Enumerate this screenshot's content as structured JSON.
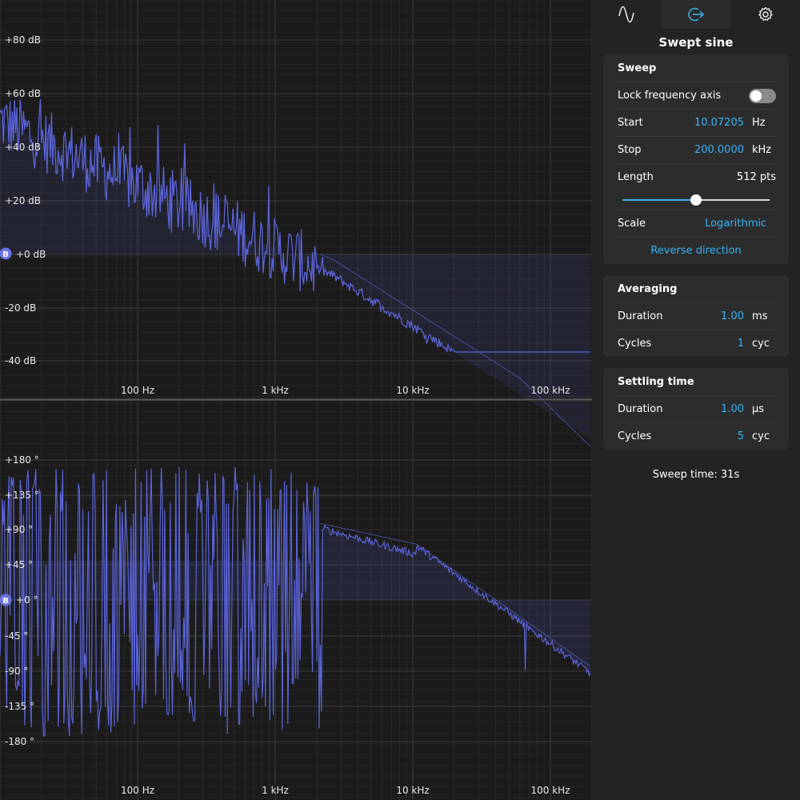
{
  "plots": {
    "magnitude": {
      "y_ticks": [
        "+80 dB",
        "+60 dB",
        "+40 dB",
        "+20 dB",
        "+0 dB",
        "-20 dB",
        "-40 dB"
      ],
      "marker_label": "B",
      "x_ticks": [
        "100 Hz",
        "1 kHz",
        "10 kHz",
        "100 kHz"
      ]
    },
    "phase": {
      "y_ticks": [
        "+180 °",
        "+135 °",
        "+90 °",
        "+45 °",
        "+0 °",
        "-45 °",
        "-90 °",
        "-135 °",
        "-180 °"
      ],
      "marker_label": "B",
      "x_ticks": [
        "100 Hz",
        "1 kHz",
        "10 kHz",
        "100 kHz"
      ]
    },
    "trace_color": "#5a63d8"
  },
  "tabs": [
    {
      "icon": "sine-wave-icon",
      "active": false
    },
    {
      "icon": "output-arrow-icon",
      "active": true
    },
    {
      "icon": "gear-icon",
      "active": false
    }
  ],
  "panel": {
    "title": "Swept sine",
    "sweep": {
      "heading": "Sweep",
      "lock_label": "Lock frequency axis",
      "lock_on": false,
      "start_label": "Start",
      "start_value": "10.07205",
      "start_unit": "Hz",
      "stop_label": "Stop",
      "stop_value": "200.0000",
      "stop_unit": "kHz",
      "length_label": "Length",
      "length_value": "512 pts",
      "length_slider_fraction": 0.5,
      "scale_label": "Scale",
      "scale_value": "Logarithmic",
      "reverse_label": "Reverse direction"
    },
    "averaging": {
      "heading": "Averaging",
      "duration_label": "Duration",
      "duration_value": "1.00",
      "duration_unit": "ms",
      "cycles_label": "Cycles",
      "cycles_value": "1",
      "cycles_unit": "cyc"
    },
    "settling": {
      "heading": "Settling time",
      "duration_label": "Duration",
      "duration_value": "1.00",
      "duration_unit": "µs",
      "cycles_label": "Cycles",
      "cycles_value": "5",
      "cycles_unit": "cyc"
    },
    "sweep_time": "Sweep time: 31s"
  },
  "colors": {
    "accent": "#39b2f5",
    "trace": "#5a63d8",
    "background": "#1b1b1b"
  }
}
